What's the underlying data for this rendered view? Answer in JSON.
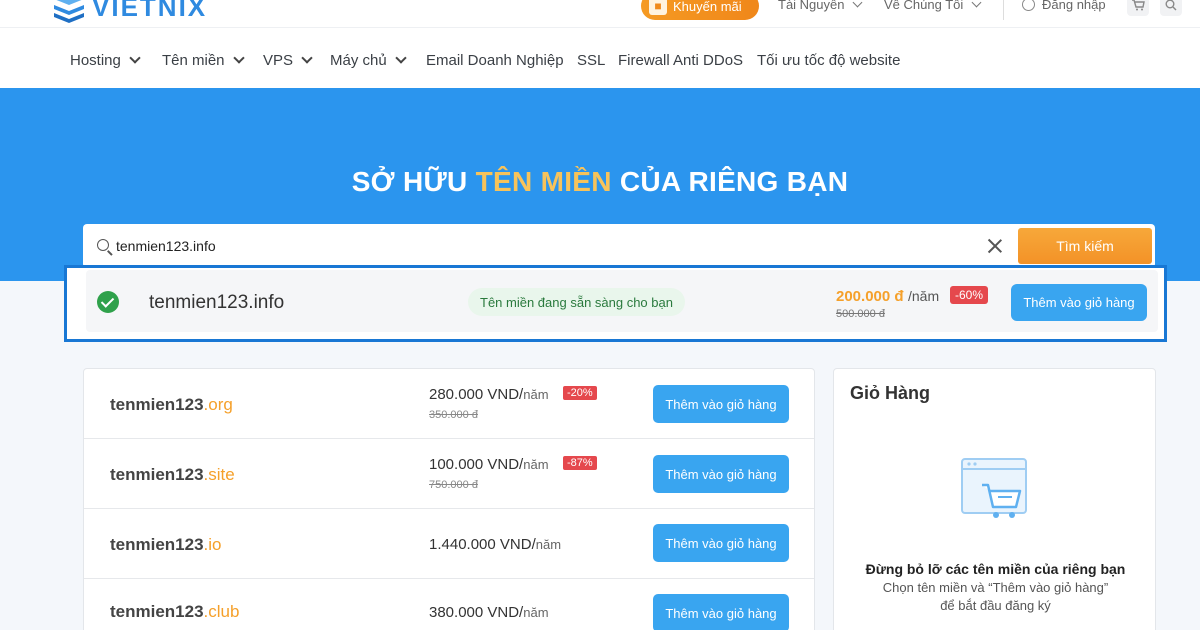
{
  "brand": {
    "name": "VIETNIX"
  },
  "topbar": {
    "promo_label": "Khuyến mãi",
    "resources_label": "Tài Nguyên",
    "about_label": "Về Chúng Tôi",
    "login_label": "Đăng nhập"
  },
  "nav": {
    "items": [
      {
        "label": "Hosting",
        "dropdown": true
      },
      {
        "label": "Tên miền",
        "dropdown": true
      },
      {
        "label": "VPS",
        "dropdown": true
      },
      {
        "label": "Máy chủ",
        "dropdown": true
      },
      {
        "label": "Email Doanh Nghiệp",
        "dropdown": false
      },
      {
        "label": "SSL",
        "dropdown": false
      },
      {
        "label": "Firewall Anti DDoS",
        "dropdown": false
      },
      {
        "label": "Tối ưu tốc độ website",
        "dropdown": false
      }
    ]
  },
  "hero": {
    "title_part1": "SỞ HỮU ",
    "title_highlight": "TÊN MIỀN",
    "title_part2": " CỦA RIÊNG BẠN"
  },
  "search": {
    "value": "tenmien123.info",
    "button_label": "Tìm kiếm"
  },
  "result": {
    "domain": "tenmien123.info",
    "status": "Tên miền đang sẵn sàng cho bạn",
    "price": "200.000 đ",
    "unit": "/năm",
    "old_price": "500.000 đ",
    "discount": "-60%",
    "button_label": "Thêm vào giỏ hàng"
  },
  "domain_list": [
    {
      "name": "tenmien123",
      "tld": ".org",
      "price": "280.000 VND/",
      "unit": "năm",
      "old_price": "350.000 đ",
      "discount": "-20%",
      "button_label": "Thêm vào giỏ hàng"
    },
    {
      "name": "tenmien123",
      "tld": ".site",
      "price": "100.000 VND/",
      "unit": "năm",
      "old_price": "750.000 đ",
      "discount": "-87%",
      "button_label": "Thêm vào giỏ hàng"
    },
    {
      "name": "tenmien123",
      "tld": ".io",
      "price": "1.440.000 VND/",
      "unit": "năm",
      "old_price": "",
      "discount": "",
      "button_label": "Thêm vào giỏ hàng"
    },
    {
      "name": "tenmien123",
      "tld": ".club",
      "price": "380.000 VND/",
      "unit": "năm",
      "old_price": "",
      "discount": "",
      "button_label": "Thêm vào giỏ hàng"
    }
  ],
  "cart": {
    "title": "Giỏ Hàng",
    "empty_heading": "Đừng bỏ lỡ các tên miền của riêng bạn",
    "empty_text": "Chọn tên miền và “Thêm vào giỏ hàng” để bắt đầu đăng ký"
  },
  "colors": {
    "primary_blue": "#2b95ee",
    "accent_orange": "#f5a02a",
    "discount_red": "#e5484d",
    "button_blue": "#39a5f0",
    "highlight_frame": "#1877d4"
  }
}
